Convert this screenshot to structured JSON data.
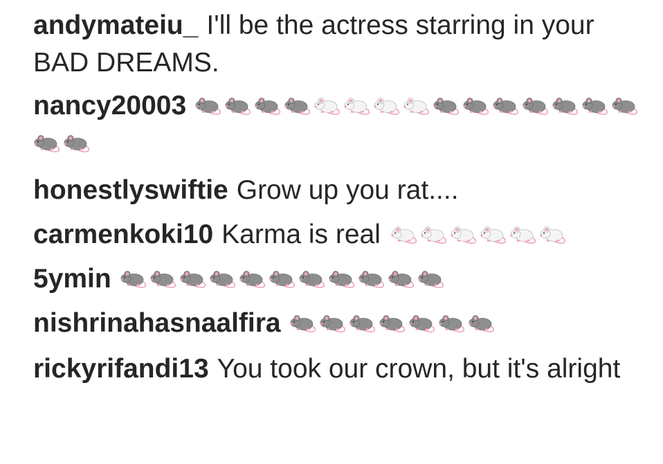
{
  "comments": [
    {
      "username": "andymateiu_",
      "text": "I'll be the actress starring in your BAD DREAMS.",
      "emojis": []
    },
    {
      "username": "nancy20003",
      "text": "",
      "emojis": [
        "rat",
        "rat",
        "rat",
        "rat",
        "mouse",
        "mouse",
        "mouse",
        "mouse",
        "rat",
        "rat",
        "rat",
        "rat",
        "rat",
        "rat",
        "rat",
        "rat",
        "rat"
      ]
    },
    {
      "username": "honestlyswiftie",
      "text": "Grow up you rat....",
      "emojis": []
    },
    {
      "username": "carmenkoki10",
      "text": "Karma is real",
      "emojis": [
        "mouse",
        "mouse",
        "mouse",
        "mouse",
        "mouse",
        "mouse"
      ]
    },
    {
      "username": "5ymin",
      "text": "",
      "emojis": [
        "rat",
        "rat",
        "rat",
        "rat",
        "rat",
        "rat",
        "rat",
        "rat",
        "rat",
        "rat",
        "rat"
      ]
    },
    {
      "username": "nishrinahasnaalfira",
      "text": "",
      "emojis": [
        "rat",
        "rat",
        "rat",
        "rat",
        "rat",
        "rat",
        "rat"
      ]
    },
    {
      "username": "rickyrifandi13",
      "text": "You took our crown, but it's alright",
      "emojis": []
    }
  ],
  "colors": {
    "text": "#262626",
    "rat_body": "#8e8e8e",
    "mouse_body": "#f4f4f4",
    "ear_pink": "#f2a3b4"
  },
  "icons": {
    "rat": "rat-icon",
    "mouse": "mouse-icon"
  }
}
